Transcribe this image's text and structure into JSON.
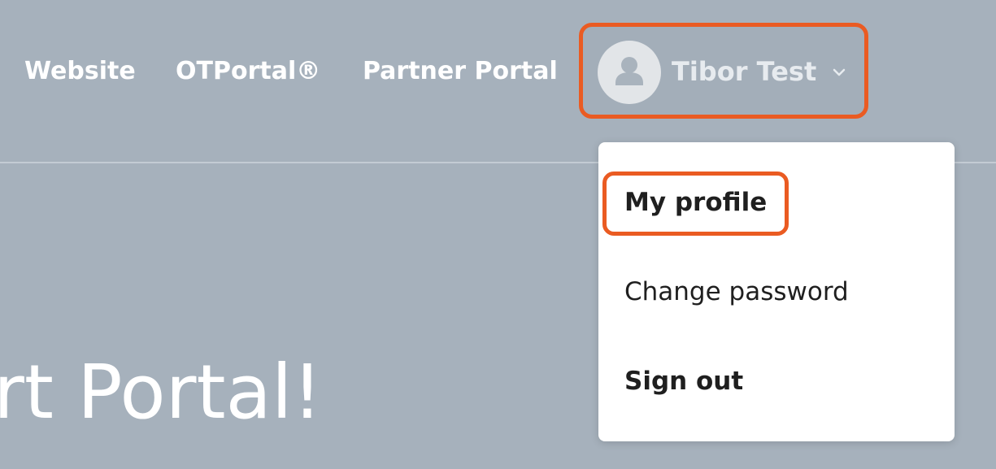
{
  "nav": {
    "links": [
      {
        "label": "Website"
      },
      {
        "label": "OTPortal®"
      },
      {
        "label": "Partner Portal"
      }
    ],
    "user_name": "Tibor Test",
    "avatar_icon": "user-silhouette-icon",
    "dropdown_icon": "chevron-down-icon"
  },
  "hero": {
    "title": "rt Portal!"
  },
  "dropdown": {
    "items": [
      {
        "label": "My profile"
      },
      {
        "label": "Change password"
      },
      {
        "label": "Sign out"
      }
    ]
  },
  "highlights": {
    "annotation_color": "#ea5b22"
  },
  "colors": {
    "page_background": "#a6b1bc",
    "menu_background": "#ffffff",
    "menu_text": "#1f1f1f"
  }
}
